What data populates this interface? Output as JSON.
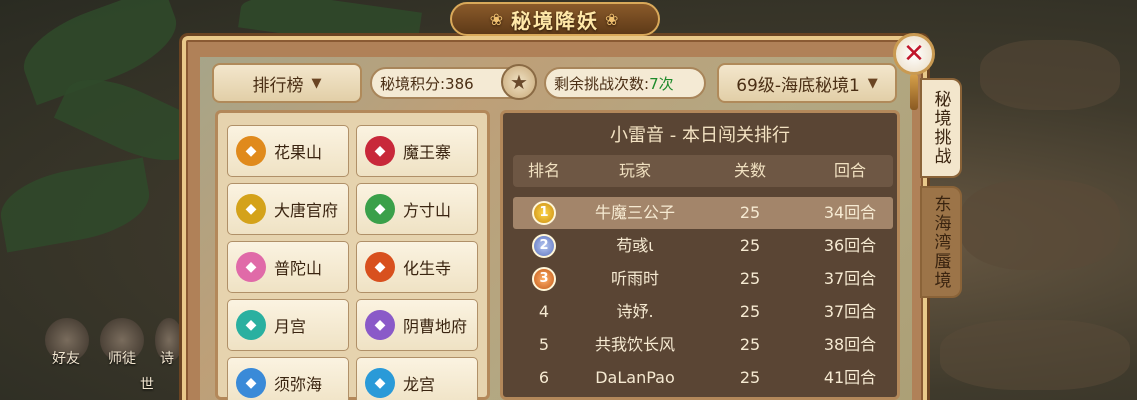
{
  "title": "秘境降妖",
  "top_bar": {
    "rank_dropdown": "排行榜",
    "score_label": "秘境积分:386",
    "tries_label": "剩余挑战次数:",
    "tries_value": "7次",
    "realm_dropdown": "69级-海底秘境1"
  },
  "side_tabs": [
    {
      "label": "秘境挑战",
      "active": true
    },
    {
      "label": "东海湾蜃境",
      "active": false
    }
  ],
  "factions": [
    {
      "label": "花果山",
      "icon": "huaguoshan-emblem-icon",
      "color": "#e08a1c"
    },
    {
      "label": "魔王寨",
      "icon": "mowangzhai-emblem-icon",
      "color": "#c8283a"
    },
    {
      "label": "大唐官府",
      "icon": "datangguanfu-emblem-icon",
      "color": "#d4a21a"
    },
    {
      "label": "方寸山",
      "icon": "fangcunshan-emblem-icon",
      "color": "#3aa04a"
    },
    {
      "label": "普陀山",
      "icon": "putuoshan-emblem-icon",
      "color": "#e06aa8"
    },
    {
      "label": "化生寺",
      "icon": "huashengsi-emblem-icon",
      "color": "#d8501e"
    },
    {
      "label": "月宫",
      "icon": "yuegong-emblem-icon",
      "color": "#2ab0a0"
    },
    {
      "label": "阴曹地府",
      "icon": "yincaodifu-emblem-icon",
      "color": "#8a5ac8"
    },
    {
      "label": "须弥海",
      "icon": "xumihai-emblem-icon",
      "color": "#3a8ad8"
    },
    {
      "label": "龙宫",
      "icon": "longgong-emblem-icon",
      "color": "#2a9ad8"
    }
  ],
  "ranking": {
    "title": "小雷音 - 本日闯关排行",
    "headers": [
      "排名",
      "玩家",
      "关数",
      "回合"
    ],
    "rows": [
      {
        "rank": "1",
        "player": "牛魔三公子",
        "stages": "25",
        "rounds": "34回合"
      },
      {
        "rank": "2",
        "player": "苟彧ι",
        "stages": "25",
        "rounds": "36回合"
      },
      {
        "rank": "3",
        "player": "听雨时",
        "stages": "25",
        "rounds": "37回合"
      },
      {
        "rank": "4",
        "player": "诗妤.",
        "stages": "25",
        "rounds": "37回合"
      },
      {
        "rank": "5",
        "player": "共我饮长风",
        "stages": "25",
        "rounds": "38回合"
      },
      {
        "rank": "6",
        "player": "DaLanPao",
        "stages": "25",
        "rounds": "41回合"
      }
    ]
  },
  "bottom_icons": [
    {
      "label": "好友"
    },
    {
      "label": "师徒"
    },
    {
      "label": "诗"
    },
    {
      "label": "世"
    }
  ]
}
